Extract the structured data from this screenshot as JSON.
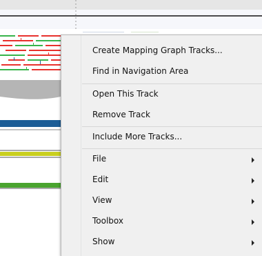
{
  "context_menu": {
    "group1": [
      {
        "label": "Create Mapping Graph Tracks...",
        "submenu": false
      },
      {
        "label": "Find in Navigation Area",
        "submenu": false
      }
    ],
    "group2": [
      {
        "label": "Open This Track",
        "submenu": false
      },
      {
        "label": "Remove Track",
        "submenu": false
      }
    ],
    "group3": [
      {
        "label": "Include More Tracks...",
        "submenu": false
      }
    ],
    "group4": [
      {
        "label": "File",
        "submenu": true
      },
      {
        "label": "Edit",
        "submenu": true
      },
      {
        "label": "View",
        "submenu": true
      },
      {
        "label": "Toolbox",
        "submenu": true
      },
      {
        "label": "Show",
        "submenu": true
      }
    ]
  },
  "colors": {
    "read_red": "#e8302c",
    "read_green": "#37b34a",
    "coverage_gray": "#b5b5b5",
    "track_blue": "#1c5d96",
    "track_yellow": "#c9cf1f",
    "track_green": "#4aa42f"
  }
}
